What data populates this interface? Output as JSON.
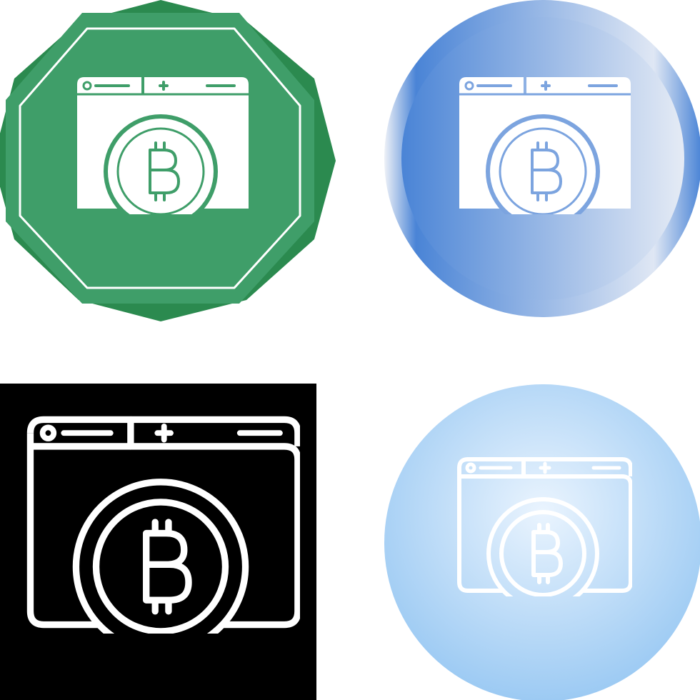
{
  "icons": [
    {
      "variant": "green-badge-glyph",
      "icon": "browser-bitcoin-icon",
      "colors": {
        "outer": "#2b8a4f",
        "inner": "#3f9e69",
        "fg": "#ffffff"
      }
    },
    {
      "variant": "blue-gradient-glyph",
      "icon": "browser-bitcoin-icon",
      "colors": {
        "start": "#4a84d6",
        "end": "#e8edf6",
        "fg": "#ffffff"
      }
    },
    {
      "variant": "black-square-outline",
      "icon": "browser-bitcoin-icon",
      "colors": {
        "bg": "#000000",
        "fg": "#ffffff"
      }
    },
    {
      "variant": "light-blue-outline",
      "icon": "browser-bitcoin-icon",
      "colors": {
        "center": "#e6f2fd",
        "edge": "#9ecbf3",
        "fg": "#ffffff"
      }
    }
  ]
}
